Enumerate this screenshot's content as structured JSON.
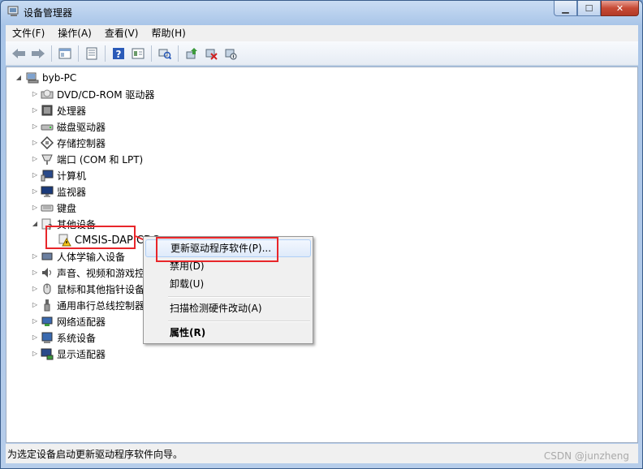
{
  "window": {
    "title": "设备管理器"
  },
  "menu": [
    "文件(F)",
    "操作(A)",
    "查看(V)",
    "帮助(H)"
  ],
  "toolbar": [
    "back-icon",
    "forward-icon",
    "show-hide-tree-icon",
    "properties-icon",
    "help-icon",
    "view-icon",
    "scan-hardware-icon",
    "update-driver-icon",
    "uninstall-icon",
    "disable-icon"
  ],
  "tree": {
    "root": "byb-PC",
    "categories": [
      "DVD/CD-ROM 驱动器",
      "处理器",
      "磁盘驱动器",
      "存储控制器",
      "端口 (COM 和 LPT)",
      "计算机",
      "监视器",
      "键盘",
      "其他设备",
      "人体学输入设备",
      "声音、视频和游戏控制器",
      "鼠标和其他指针设备",
      "通用串行总线控制器",
      "网络适配器",
      "系统设备",
      "显示适配器"
    ],
    "child_device": "CMSIS-DAP CDC"
  },
  "context_menu": {
    "update": "更新驱动程序软件(P)...",
    "disable": "禁用(D)",
    "uninstall": "卸载(U)",
    "scan": "扫描检测硬件改动(A)",
    "properties": "属性(R)"
  },
  "status": {
    "text": "为选定设备启动更新驱动程序软件向导。"
  },
  "watermark": "CSDN @junzheng",
  "colors": {
    "highlight_border": "#e8262a",
    "menu_bg": "#f0f0f0"
  }
}
